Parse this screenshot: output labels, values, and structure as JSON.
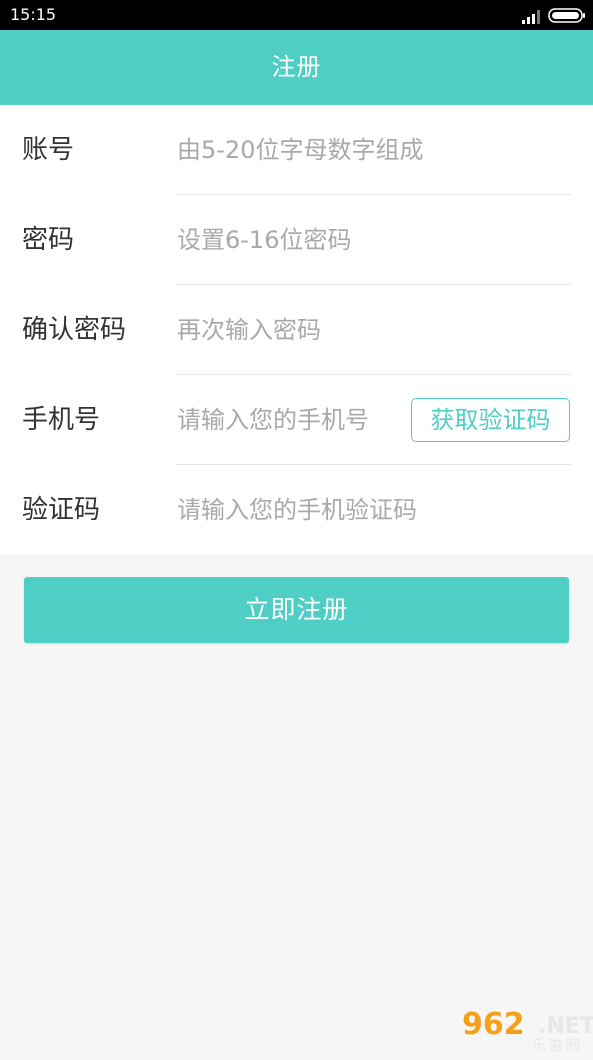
{
  "status_bar": {
    "time": "15:15",
    "signal_icon": "signal-icon",
    "battery_icon": "battery-icon"
  },
  "header": {
    "title": "注册"
  },
  "form": {
    "account": {
      "label": "账号",
      "placeholder": "由5-20位字母数字组成"
    },
    "password": {
      "label": "密码",
      "placeholder": "设置6-16位密码"
    },
    "confirm": {
      "label": "确认密码",
      "placeholder": "再次输入密码"
    },
    "phone": {
      "label": "手机号",
      "placeholder": "请输入您的手机号",
      "code_button": "获取验证码"
    },
    "code": {
      "label": "验证码",
      "placeholder": "请输入您的手机验证码"
    }
  },
  "submit_label": "立即注册",
  "watermark": {
    "number": "962",
    "net": ".NET",
    "cn": "乐游网"
  },
  "colors": {
    "accent": "#4fcec5",
    "background": "#f6f6f6",
    "label_text": "#333333",
    "placeholder_text": "#a9a9a9"
  }
}
